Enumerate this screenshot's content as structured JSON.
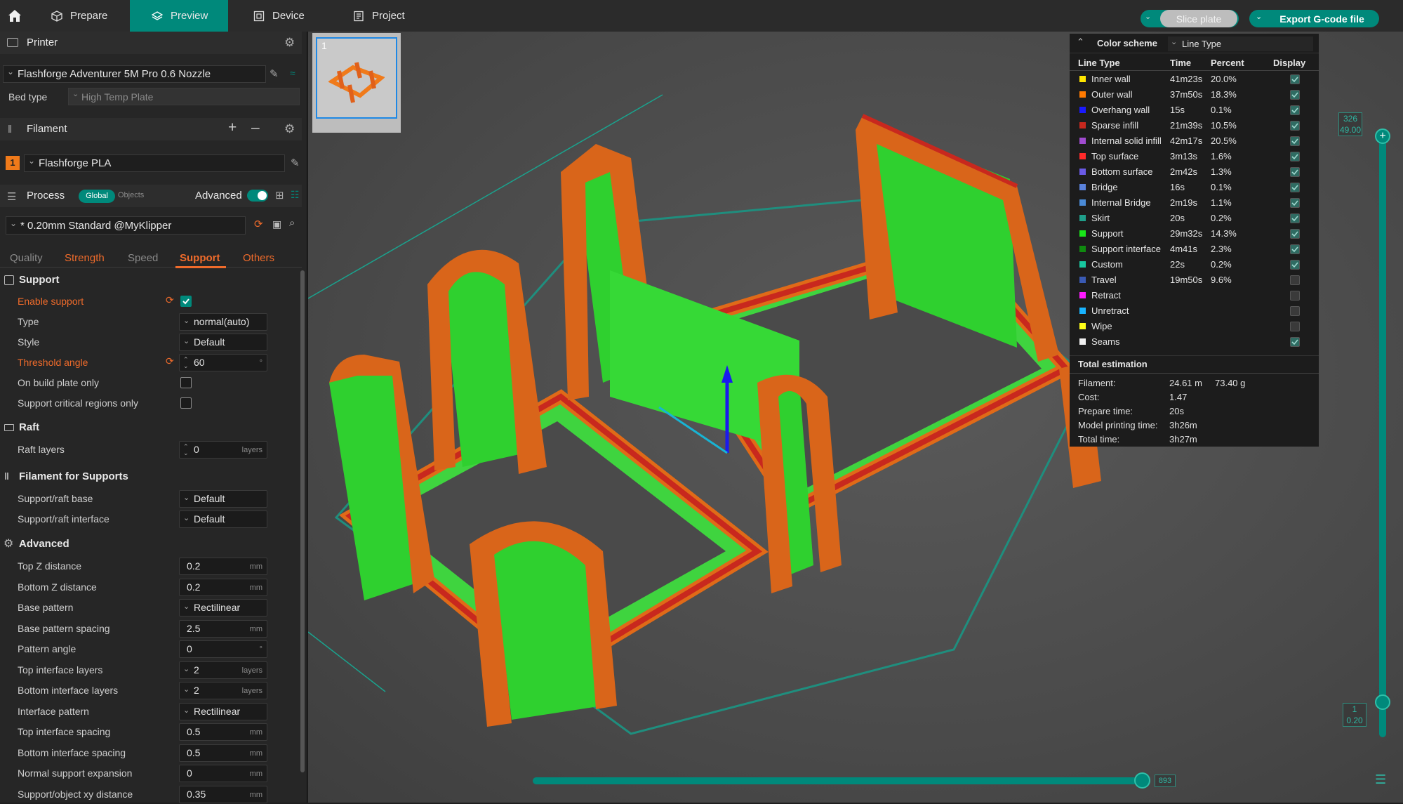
{
  "topbar": {
    "tabs": [
      {
        "label": "Prepare",
        "icon": "cube-icon"
      },
      {
        "label": "Preview",
        "icon": "layers-icon"
      },
      {
        "label": "Device",
        "icon": "device-icon"
      },
      {
        "label": "Project",
        "icon": "project-icon"
      }
    ],
    "active_tab": "Preview",
    "slice_label": "Slice plate",
    "export_label": "Export G-code file",
    "accent": "#00897b"
  },
  "printer": {
    "header": "Printer",
    "name": "Flashforge Adventurer 5M Pro 0.6 Nozzle",
    "bed_type_label": "Bed type",
    "bed_type": "High Temp Plate"
  },
  "filament": {
    "header": "Filament",
    "index": "1",
    "name": "Flashforge PLA",
    "color": "#f07a1a"
  },
  "process": {
    "header": "Process",
    "global_label": "Global",
    "objects_label": "Objects",
    "advanced_label": "Advanced",
    "preset": "* 0.20mm Standard @MyKlipper",
    "tabs": [
      "Quality",
      "Strength",
      "Speed",
      "Support",
      "Others"
    ],
    "active_tab": "Support"
  },
  "support": {
    "title": "Support",
    "enable_label": "Enable support",
    "type_label": "Type",
    "type_value": "normal(auto)",
    "style_label": "Style",
    "style_value": "Default",
    "threshold_label": "Threshold angle",
    "threshold_value": "60",
    "threshold_unit": "°",
    "build_plate_label": "On build plate only",
    "critical_label": "Support critical regions only"
  },
  "raft": {
    "title": "Raft",
    "layers_label": "Raft layers",
    "layers_value": "0",
    "layers_unit": "layers"
  },
  "filament_supports": {
    "title": "Filament for Supports",
    "base_label": "Support/raft base",
    "base_value": "Default",
    "interface_label": "Support/raft interface",
    "interface_value": "Default"
  },
  "advanced": {
    "title": "Advanced",
    "rows": [
      {
        "label": "Top Z distance",
        "value": "0.2",
        "unit": "mm",
        "dd": false
      },
      {
        "label": "Bottom Z distance",
        "value": "0.2",
        "unit": "mm",
        "dd": false
      },
      {
        "label": "Base pattern",
        "value": "Rectilinear",
        "unit": "",
        "dd": true
      },
      {
        "label": "Base pattern spacing",
        "value": "2.5",
        "unit": "mm",
        "dd": false
      },
      {
        "label": "Pattern angle",
        "value": "0",
        "unit": "°",
        "dd": false
      },
      {
        "label": "Top interface layers",
        "value": "2",
        "unit": "layers",
        "dd": true
      },
      {
        "label": "Bottom interface layers",
        "value": "2",
        "unit": "layers",
        "dd": true
      },
      {
        "label": "Interface pattern",
        "value": "Rectilinear",
        "unit": "",
        "dd": true
      },
      {
        "label": "Top interface spacing",
        "value": "0.5",
        "unit": "mm",
        "dd": false
      },
      {
        "label": "Bottom interface spacing",
        "value": "0.5",
        "unit": "mm",
        "dd": false
      },
      {
        "label": "Normal support expansion",
        "value": "0",
        "unit": "mm",
        "dd": false
      },
      {
        "label": "Support/object xy distance",
        "value": "0.35",
        "unit": "mm",
        "dd": false
      }
    ]
  },
  "plate": {
    "number": "1"
  },
  "legend": {
    "title": "Color scheme",
    "scheme": "Line Type",
    "headers": [
      "Line Type",
      "Time",
      "Percent",
      "Display"
    ],
    "items": [
      {
        "name": "Inner wall",
        "time": "41m23s",
        "percent": "20.0%",
        "color": "#ffe600",
        "on": true
      },
      {
        "name": "Outer wall",
        "time": "37m50s",
        "percent": "18.3%",
        "color": "#ff7a00",
        "on": true
      },
      {
        "name": "Overhang wall",
        "time": "15s",
        "percent": "0.1%",
        "color": "#1a1aff",
        "on": true
      },
      {
        "name": "Sparse infill",
        "time": "21m39s",
        "percent": "10.5%",
        "color": "#c8281e",
        "on": true
      },
      {
        "name": "Internal solid infill",
        "time": "42m17s",
        "percent": "20.5%",
        "color": "#a04bd0",
        "on": true
      },
      {
        "name": "Top surface",
        "time": "3m13s",
        "percent": "1.6%",
        "color": "#ff2a2a",
        "on": true
      },
      {
        "name": "Bottom surface",
        "time": "2m42s",
        "percent": "1.3%",
        "color": "#6a5ae6",
        "on": true
      },
      {
        "name": "Bridge",
        "time": "16s",
        "percent": "0.1%",
        "color": "#5a82dc",
        "on": true
      },
      {
        "name": "Internal Bridge",
        "time": "2m19s",
        "percent": "1.1%",
        "color": "#4a8ad6",
        "on": true
      },
      {
        "name": "Skirt",
        "time": "20s",
        "percent": "0.2%",
        "color": "#1f9e8a",
        "on": true
      },
      {
        "name": "Support",
        "time": "29m32s",
        "percent": "14.3%",
        "color": "#19e619",
        "on": true
      },
      {
        "name": "Support interface",
        "time": "4m41s",
        "percent": "2.3%",
        "color": "#0f8a0f",
        "on": true
      },
      {
        "name": "Custom",
        "time": "22s",
        "percent": "0.2%",
        "color": "#18c8a0",
        "on": true
      },
      {
        "name": "Travel",
        "time": "19m50s",
        "percent": "9.6%",
        "color": "#3a5ab4",
        "on": false
      },
      {
        "name": "Retract",
        "time": "",
        "percent": "",
        "color": "#ff19ff",
        "on": false
      },
      {
        "name": "Unretract",
        "time": "",
        "percent": "",
        "color": "#19b4ff",
        "on": false
      },
      {
        "name": "Wipe",
        "time": "",
        "percent": "",
        "color": "#ffff19",
        "on": false
      },
      {
        "name": "Seams",
        "time": "",
        "percent": "",
        "color": "#f0f0f0",
        "on": true
      }
    ],
    "total_title": "Total estimation",
    "filament_label": "Filament:",
    "filament_length": "24.61 m",
    "filament_weight": "73.40 g",
    "cost_label": "Cost:",
    "cost": "1.47",
    "prepare_label": "Prepare time:",
    "prepare": "20s",
    "model_label": "Model printing time:",
    "model": "3h26m",
    "total_label": "Total time:",
    "total": "3h27m"
  },
  "layer_slider": {
    "top_layer": "326",
    "top_height": "49.00",
    "bottom_layer": "1",
    "bottom_height": "0.20"
  },
  "move_slider": {
    "value": "893"
  }
}
